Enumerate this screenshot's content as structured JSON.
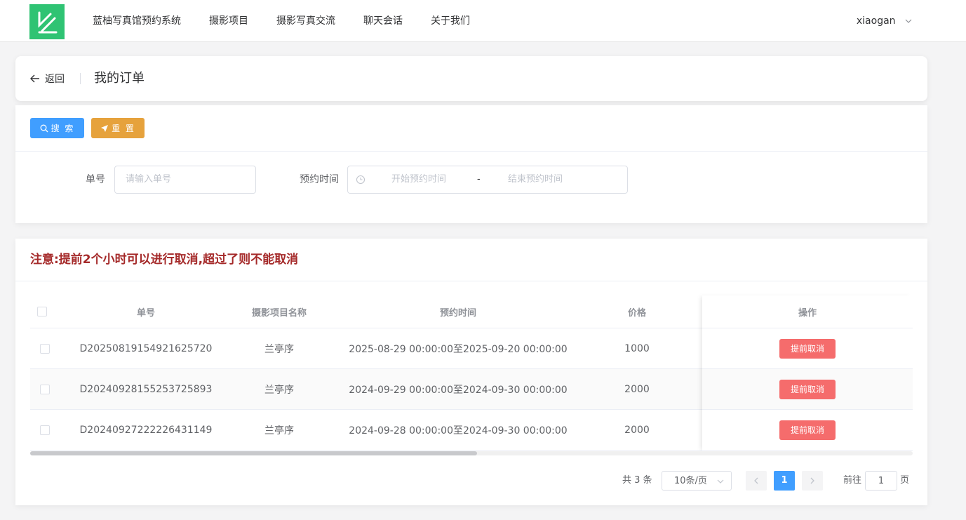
{
  "nav": {
    "logo_icon": "brand-logo-icon",
    "items": [
      "蓝柚写真馆预约系统",
      "摄影项目",
      "摄影写真交流",
      "聊天会话",
      "关于我们"
    ],
    "user": "xiaogan"
  },
  "header": {
    "back_label": "返回",
    "title": "我的订单"
  },
  "search": {
    "search_label": "搜 索",
    "reset_label": "重 置",
    "order_label": "单号",
    "order_placeholder": "请输入单号",
    "time_label": "预约时间",
    "start_placeholder": "开始预约时间",
    "range_sep": "-",
    "end_placeholder": "结束预约时间"
  },
  "notice": "注意:提前2个小时可以进行取消,超过了则不能取消",
  "table": {
    "columns": [
      "单号",
      "摄影项目名称",
      "预约时间",
      "价格",
      "操作"
    ],
    "rows": [
      {
        "order_no": "D20250819154921625720",
        "project": "兰亭序",
        "time": "2025-08-29 00:00:00至2025-09-20 00:00:00",
        "price": "1000",
        "action": "提前取消"
      },
      {
        "order_no": "D20240928155253725893",
        "project": "兰亭序",
        "time": "2024-09-29 00:00:00至2024-09-30 00:00:00",
        "price": "2000",
        "action": "提前取消"
      },
      {
        "order_no": "D20240927222226431149",
        "project": "兰亭序",
        "time": "2024-09-28 00:00:00至2024-09-30 00:00:00",
        "price": "2000",
        "action": "提前取消"
      }
    ]
  },
  "pagination": {
    "total": "共 3 条",
    "page_size": "10条/页",
    "current_page": "1",
    "goto_label": "前往",
    "goto_value": "1",
    "page_label": "页"
  },
  "colors": {
    "brand": "#2fc373",
    "primary": "#409eff",
    "warning": "#e6a23c",
    "danger": "#f56c6c",
    "notice": "#a52a2a"
  }
}
